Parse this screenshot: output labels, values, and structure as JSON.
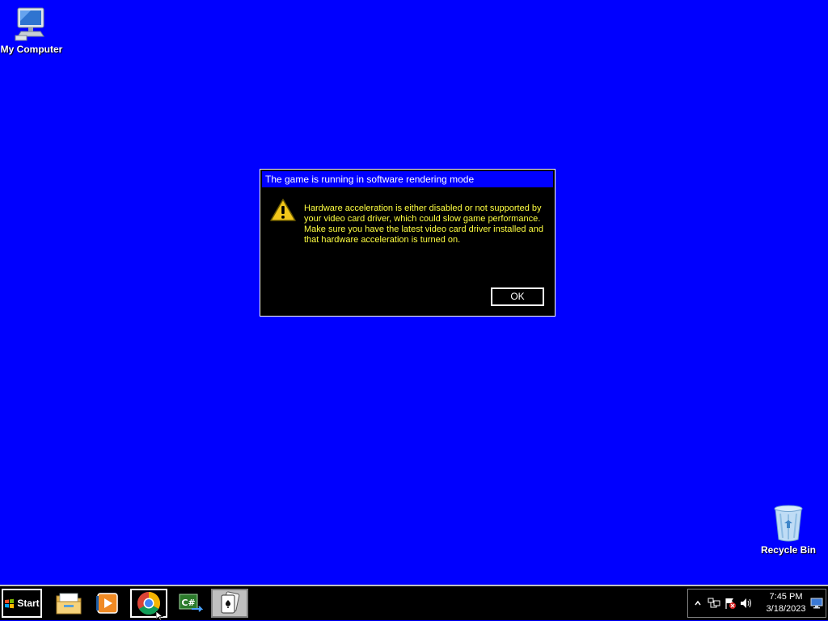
{
  "desktop": {
    "background_color": "#0000ff",
    "icons": [
      {
        "label": "My Computer",
        "icon": "computer-icon"
      },
      {
        "label": "Recycle Bin",
        "icon": "recycle-bin-icon"
      }
    ]
  },
  "dialog": {
    "title": "The game is running in software rendering mode",
    "icon": "warning-icon",
    "message": "Hardware acceleration is either disabled or not supported by your video card driver, which could slow game performance. Make sure you have the latest video card driver installed and that hardware acceleration is turned on.",
    "ok_label": "OK",
    "text_color": "#ffff40"
  },
  "taskbar": {
    "start_label": "Start",
    "apps": [
      {
        "name": "File Explorer",
        "icon": "folder-icon"
      },
      {
        "name": "Windows Media Player",
        "icon": "media-player-icon"
      },
      {
        "name": "Google Chrome",
        "icon": "chrome-icon"
      },
      {
        "name": "C# Editor",
        "icon": "csharp-icon"
      },
      {
        "name": "Solitaire",
        "icon": "cards-icon"
      }
    ],
    "tray": {
      "icons": [
        "chevron-up-icon",
        "network-icon",
        "action-center-icon",
        "volume-icon"
      ],
      "time": "7:45 PM",
      "date": "3/18/2023"
    }
  }
}
